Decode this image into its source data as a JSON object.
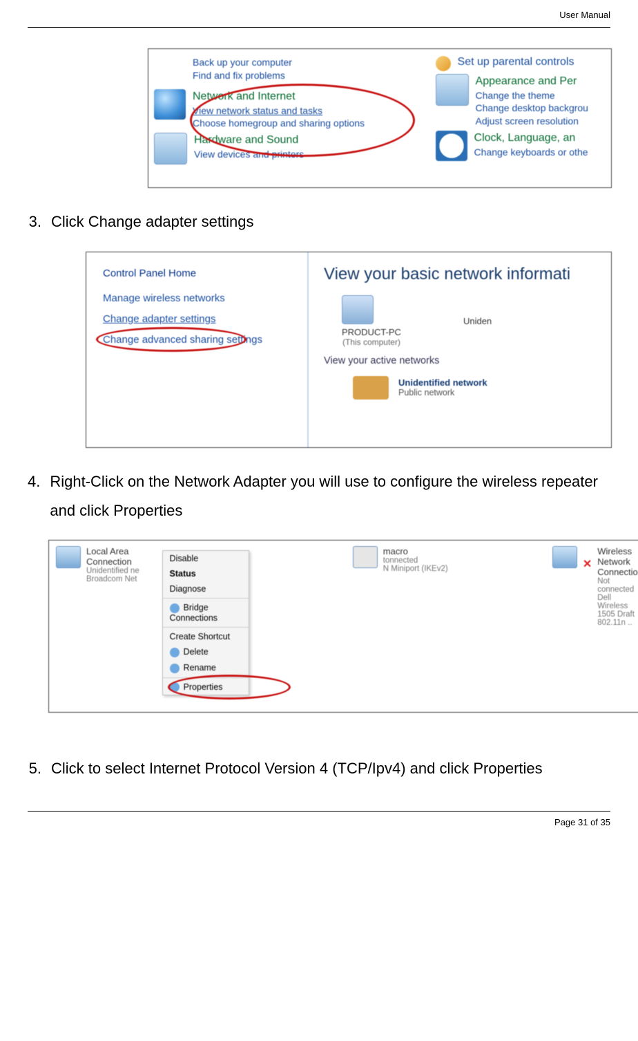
{
  "header": {
    "doc_title": "User Manual"
  },
  "footer": {
    "page_label": "Page 31 of 35"
  },
  "steps": {
    "s3": {
      "num": "3.",
      "text": "Click Change adapter settings"
    },
    "s4": {
      "num": "4.",
      "text": "Right-Click on the Network Adapter you will use to configure the wireless repeater and click Properties"
    },
    "s5": {
      "num": "5.",
      "text": "Click to select Internet Protocol Version 4 (TCP/Ipv4) and click Properties"
    }
  },
  "fig1": {
    "left": {
      "backup": "Back up your computer",
      "fix": "Find and fix problems",
      "net_title": "Network and Internet",
      "net_l1": "View network status and tasks",
      "net_l2": "Choose homegroup and sharing options",
      "hw_title": "Hardware and Sound",
      "hw_l1": "View devices and printers"
    },
    "right": {
      "parental": "Set up parental controls",
      "app_title": "Appearance and Per",
      "app_l1": "Change the theme",
      "app_l2": "Change desktop backgrou",
      "app_l3": "Adjust screen resolution",
      "clk_title": "Clock, Language, an",
      "clk_l1": "Change keyboards or othe"
    }
  },
  "fig2": {
    "left": {
      "home": "Control Panel Home",
      "n1": "Manage wireless networks",
      "n2": "Change adapter settings",
      "n3": "Change advanced sharing settings"
    },
    "right": {
      "title": "View your basic network informati",
      "pc": "PRODUCT-PC",
      "pc_sub": "(This computer)",
      "uniden": "Uniden",
      "active": "View your active networks",
      "unet": "Unidentified network",
      "pub": "Public network"
    }
  },
  "fig3": {
    "c1": {
      "title": "Local Area Connection",
      "l1": "Unidentified ne",
      "l2": "Broadcom Net"
    },
    "c2": {
      "title": "macro",
      "l1": "tonnected",
      "l2": "N Miniport (IKEv2)"
    },
    "c3": {
      "title": "Wireless Network Connection",
      "l1": "Not connected",
      "l2": "Dell Wireless 1505 Draft 802.11n .."
    },
    "menu": {
      "m1": "Disable",
      "m2": "Status",
      "m3": "Diagnose",
      "m4": "Bridge Connections",
      "m5": "Create Shortcut",
      "m6": "Delete",
      "m7": "Rename",
      "m8": "Properties"
    }
  }
}
